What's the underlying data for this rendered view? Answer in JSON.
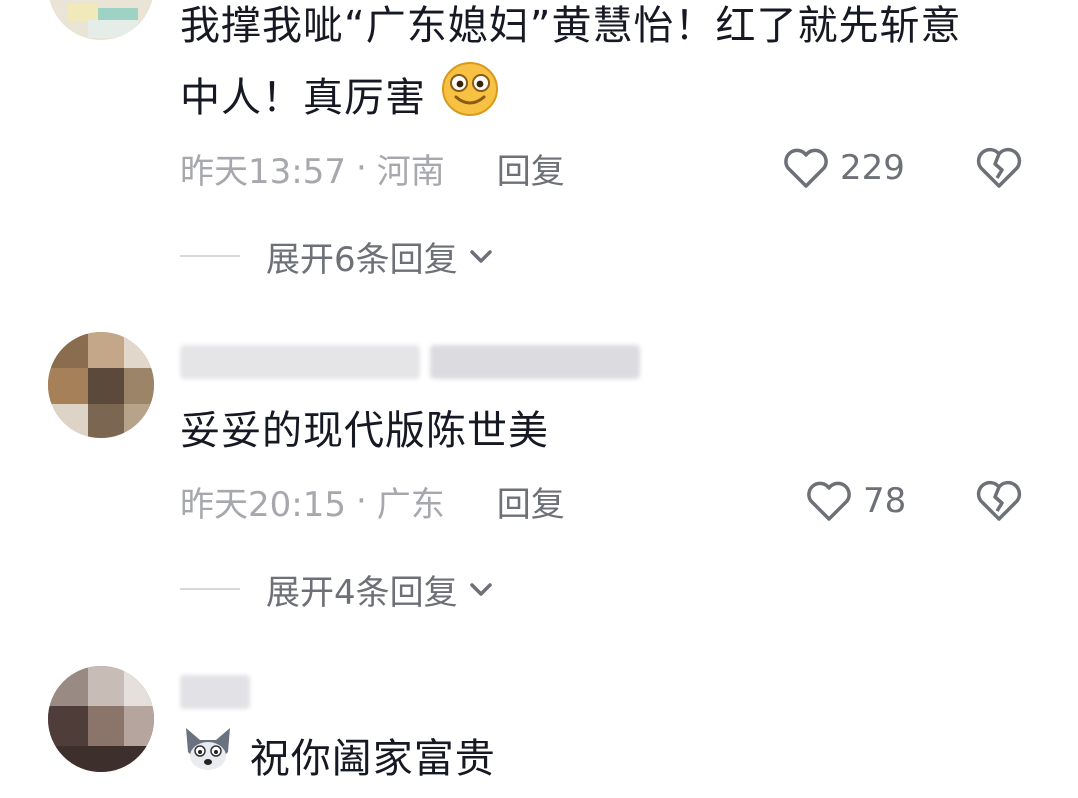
{
  "comments": [
    {
      "text_line1": "我撑我呲“广东媳妇”黄慧怡！红了就先斩意",
      "text_line2": "中人！真厉害",
      "emoji": "smile-emoji",
      "time": "昨天13:57",
      "sep": "·",
      "location": "河南",
      "reply": "回复",
      "likes": "229",
      "expand": "展开6条回复"
    },
    {
      "text": "妥妥的现代版陈世美",
      "time": "昨天20:15",
      "sep": "·",
      "location": "广东",
      "reply": "回复",
      "likes": "78",
      "expand": "展开4条回复"
    },
    {
      "text": "祝你阖家富贵",
      "emoji": "wolf-emoji"
    }
  ],
  "colors": {
    "primary_text": "#161823",
    "meta_text": "#a7a8ad",
    "secondary_text": "#6e7078"
  },
  "icons": {
    "like": "heart-outline-icon",
    "dislike": "broken-heart-icon",
    "expand": "chevron-down-icon"
  }
}
